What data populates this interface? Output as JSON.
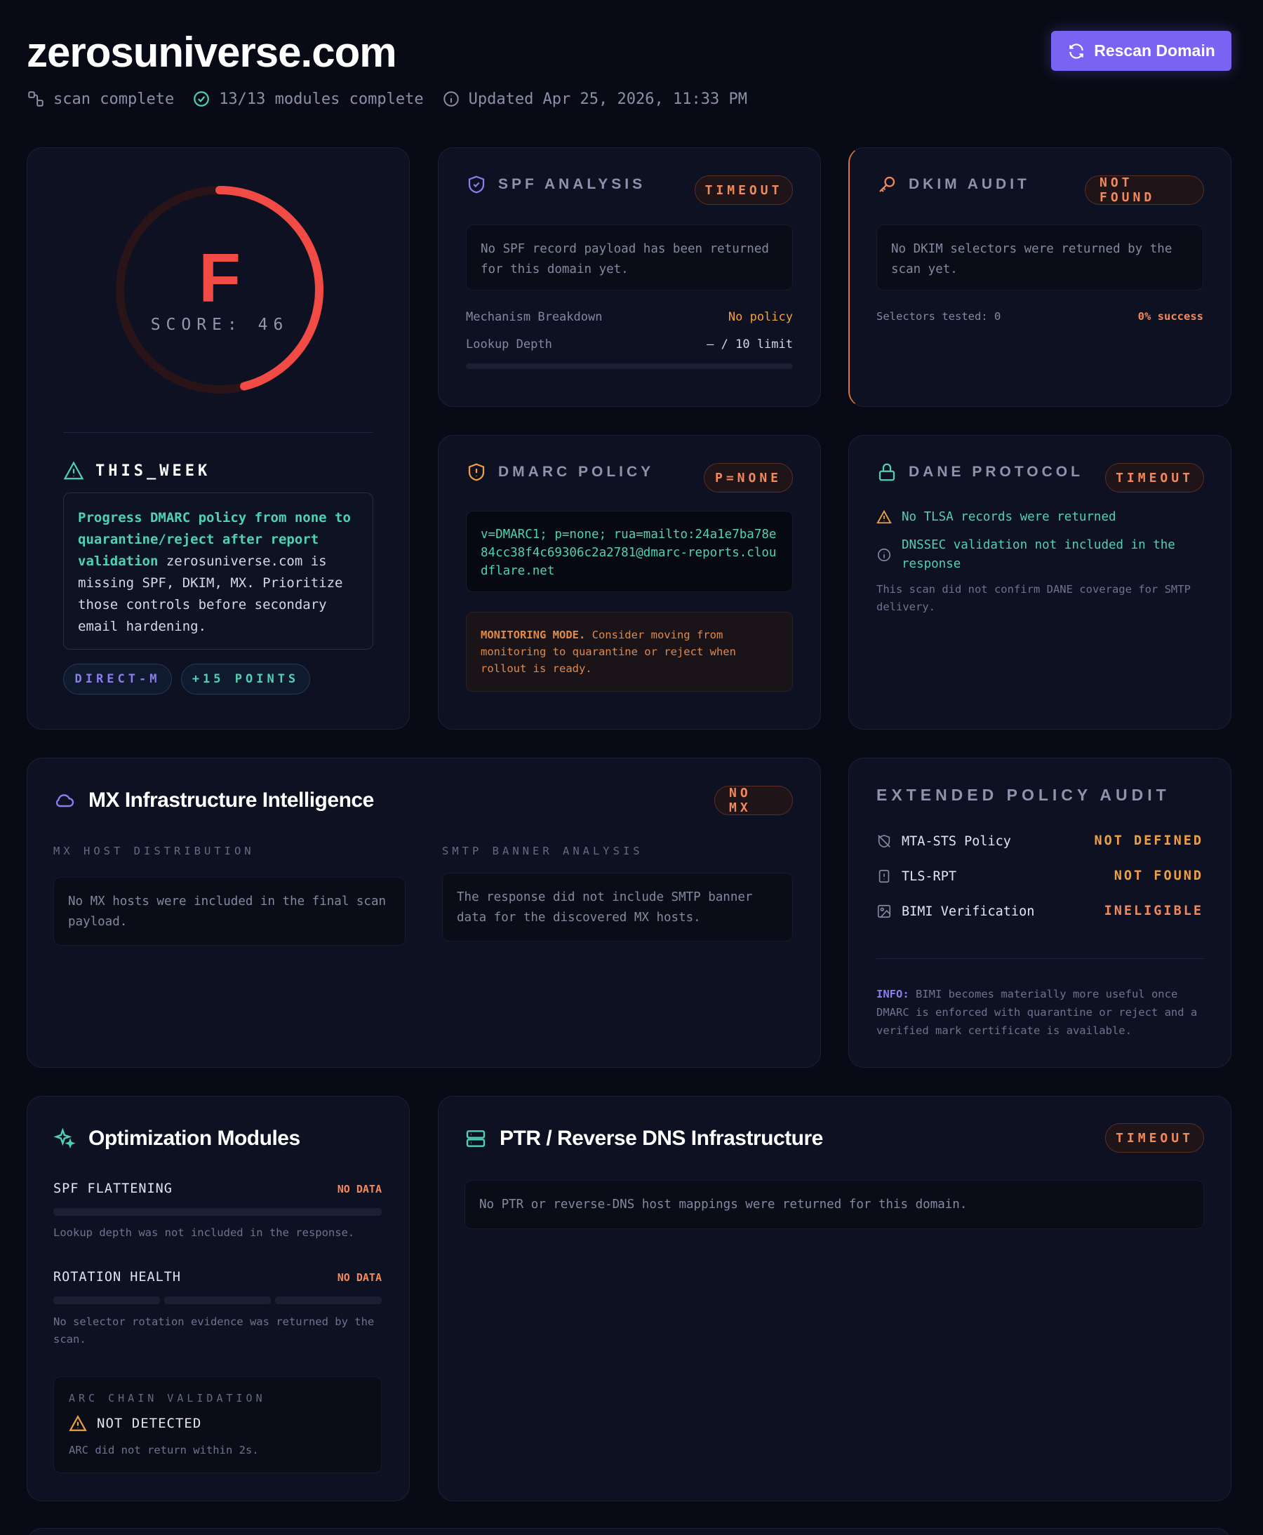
{
  "header": {
    "title": "zerosuniverse.com",
    "status": "scan complete",
    "modules": "13/13 modules complete",
    "updated": "Updated Apr 25, 2026, 11:33 PM",
    "rescan_label": "Rescan Domain"
  },
  "grade_card": {
    "grade": "F",
    "score_label": "SCORE: 46",
    "score_fraction": 0.46,
    "this_week_title": "THIS_WEEK",
    "action_highlight": "Progress DMARC policy from none to quarantine/reject after report validation",
    "action_rest": " zerosuniverse.com is missing SPF, DKIM, MX. Prioritize those controls before secondary email hardening.",
    "pill_direct": "DIRECT-M",
    "pill_points": "+15 POINTS"
  },
  "spf": {
    "title": "SPF ANALYSIS",
    "badge": "TIMEOUT",
    "message": "No SPF record payload has been returned for this domain yet.",
    "mechanism_label": "Mechanism Breakdown",
    "mechanism_value": "No policy",
    "lookup_label": "Lookup Depth",
    "lookup_value": "— / 10 limit"
  },
  "dkim": {
    "title": "DKIM AUDIT",
    "badge": "NOT FOUND",
    "message": "No DKIM selectors were returned by the scan yet.",
    "selectors_label": "Selectors tested: 0",
    "success_label": "0% success"
  },
  "dmarc": {
    "title": "DMARC POLICY",
    "badge": "P=NONE",
    "record": "v=DMARC1; p=none; rua=mailto:24a1e7ba78e84cc38f4c69306c2a2781@dmarc-reports.cloudflare.net",
    "monitor_strong": "MONITORING MODE.",
    "monitor_text": " Consider moving from monitoring to quarantine or reject when rollout is ready."
  },
  "dane": {
    "title": "DANE PROTOCOL",
    "badge": "TIMEOUT",
    "line1": "No TLSA records were returned",
    "line2": "DNSSEC validation not included in the response",
    "note": "This scan did not confirm DANE coverage for SMTP delivery."
  },
  "mx": {
    "title": "MX Infrastructure Intelligence",
    "badge": "NO MX",
    "dist_label": "MX HOST DISTRIBUTION",
    "dist_text": "No MX hosts were included in the final scan payload.",
    "banner_label": "SMTP BANNER ANALYSIS",
    "banner_text": "The response did not include SMTP banner data for the discovered MX hosts."
  },
  "extended": {
    "title": "EXTENDED POLICY AUDIT",
    "items": [
      {
        "label": "MTA-STS Policy",
        "value": "NOT DEFINED"
      },
      {
        "label": "TLS-RPT",
        "value": "NOT FOUND"
      },
      {
        "label": "BIMI Verification",
        "value": "INELIGIBLE"
      }
    ],
    "info_strong": "INFO:",
    "info_text": " BIMI becomes materially more useful once DMARC is enforced with quarantine or reject and a verified mark certificate is available."
  },
  "optimization": {
    "title": "Optimization Modules",
    "spf_label": "SPF FLATTENING",
    "spf_value": "NO DATA",
    "spf_note": "Lookup depth was not included in the response.",
    "rotation_label": "ROTATION HEALTH",
    "rotation_value": "NO DATA",
    "rotation_note": "No selector rotation evidence was returned by the scan.",
    "arc_label": "ARC CHAIN VALIDATION",
    "arc_value": "NOT DETECTED",
    "arc_note": "ARC did not return within 2s."
  },
  "ptr": {
    "title": "PTR / Reverse DNS Infrastructure",
    "badge": "TIMEOUT",
    "message": "No PTR or reverse-DNS host mappings were returned for this domain."
  },
  "colors": {
    "accent": "#7a63f2",
    "danger": "#f24b45",
    "warning": "#f08a5c",
    "success_text": "#4fd1b5"
  }
}
